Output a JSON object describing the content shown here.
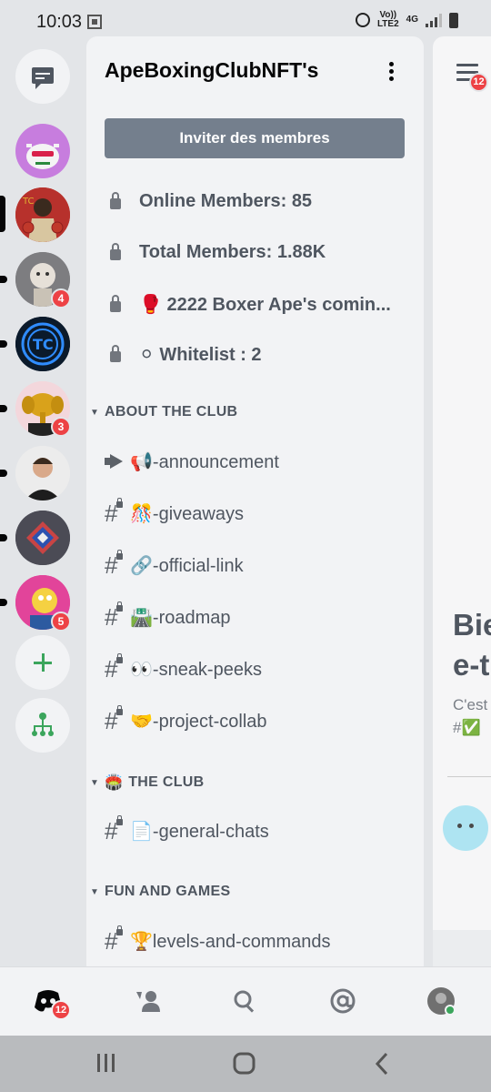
{
  "status_bar": {
    "time": "10:03",
    "network_top": "Vo))",
    "network_bottom": "LTE2",
    "signal_type": "4G",
    "icons": [
      "qr-icon",
      "alarm-icon",
      "signal-icon",
      "battery-icon"
    ]
  },
  "servers": {
    "items": [
      {
        "name": "direct-messages",
        "icon": "chat-bubble-icon"
      },
      {
        "name": "server-axolotl",
        "color": "#c77dde"
      },
      {
        "name": "server-apeboxingclub",
        "color": "#c0392b",
        "selected": true
      },
      {
        "name": "server-robot",
        "color": "#8d8d8d",
        "badge": "4"
      },
      {
        "name": "server-tc",
        "color": "#1e6bb8"
      },
      {
        "name": "server-elephant",
        "color": "#d4a017",
        "badge": "3"
      },
      {
        "name": "server-person",
        "color": "#e8e8e8"
      },
      {
        "name": "server-diamond",
        "color": "#5a5a6a"
      },
      {
        "name": "server-cartoon",
        "color": "#e84393",
        "badge": "5"
      }
    ],
    "add_icon": "plus-icon",
    "explore_icon": "hub-icon"
  },
  "panel": {
    "server_name": "ApeBoxingClubNFT's",
    "invite_label": "Inviter des membres",
    "stats": [
      {
        "emoji": "",
        "label": "Online Members: 85"
      },
      {
        "emoji": "",
        "label": "Total Members: 1.88K"
      },
      {
        "emoji": "🥊",
        "label": "2222 Boxer Ape's comin..."
      },
      {
        "emoji": "⚪",
        "label": "Whitelist : 2"
      }
    ],
    "categories": [
      {
        "emoji": "",
        "label": "ABOUT THE CLUB",
        "channels": [
          {
            "type": "announcement",
            "emoji": "📢",
            "label": "-announcement"
          },
          {
            "type": "text",
            "emoji": "🎊",
            "label": "-giveaways"
          },
          {
            "type": "text",
            "emoji": "🔗",
            "label": "-official-link"
          },
          {
            "type": "text",
            "emoji": "🛣️",
            "label": "-roadmap"
          },
          {
            "type": "text",
            "emoji": "👀",
            "label": "-sneak-peeks"
          },
          {
            "type": "text",
            "emoji": "🤝",
            "label": "-project-collab"
          }
        ]
      },
      {
        "emoji": "🏟️",
        "label": "THE CLUB",
        "channels": [
          {
            "type": "text",
            "emoji": "📄",
            "label": "-general-chats"
          }
        ]
      },
      {
        "emoji": "",
        "label": "FUN AND GAMES",
        "channels": [
          {
            "type": "text",
            "emoji": "🏆",
            "label": "levels-and-commands"
          }
        ]
      }
    ]
  },
  "chat": {
    "menu_badge": "12",
    "welcome_line1": "Bie",
    "welcome_line2": "e-t",
    "subtitle_line1": "C'est",
    "subtitle_line2": "#✅"
  },
  "bottom_nav": {
    "home_badge": "12",
    "items": [
      "home-icon",
      "friends-icon",
      "search-icon",
      "mentions-icon",
      "profile-avatar"
    ]
  },
  "colors": {
    "rail_bg": "#e3e5e8",
    "panel_bg": "#f2f3f5",
    "badge_red": "#ed4245",
    "invite_btn": "#747f8d",
    "green": "#3ba55c"
  }
}
